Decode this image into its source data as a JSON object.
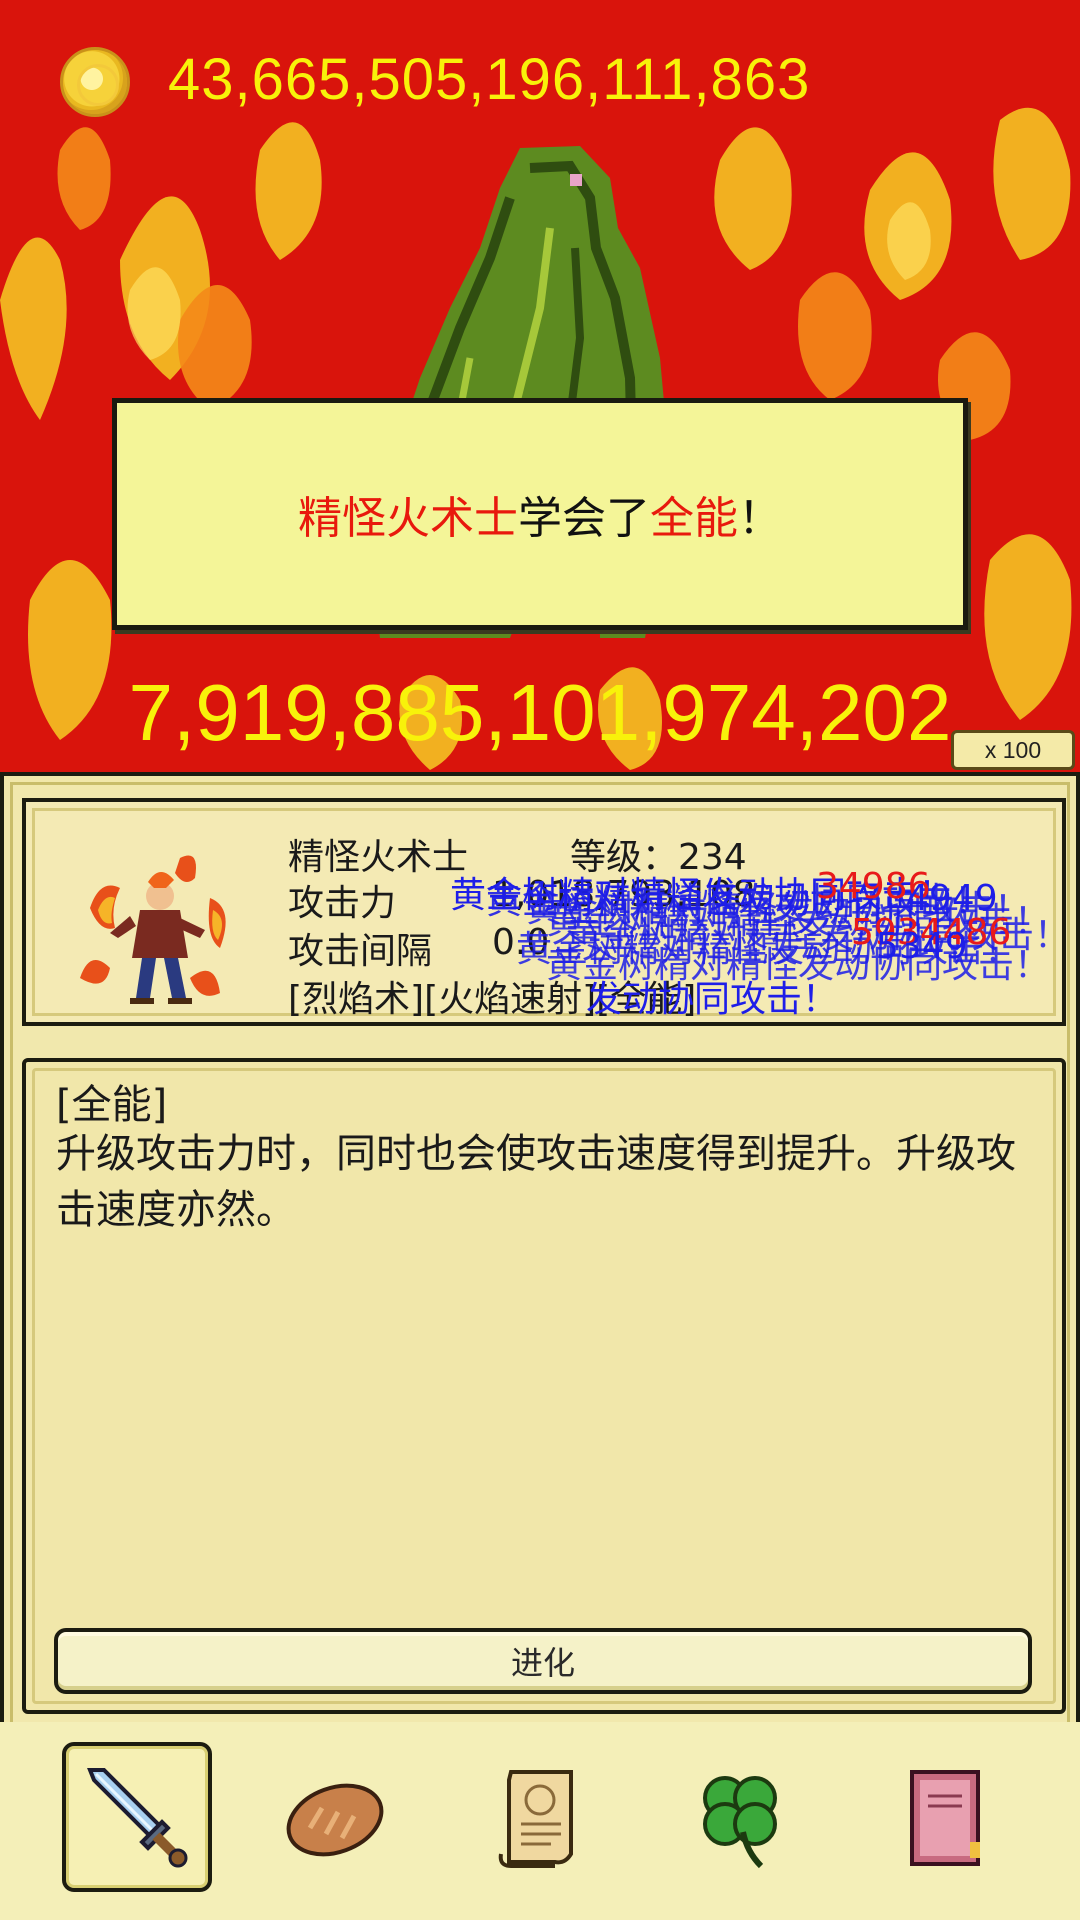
{
  "scene": {
    "gold_amount": "43,665,505,196,111,863",
    "damage_number": "7,919,885,101,974,202",
    "multiplier_label": "x 100",
    "dialog": {
      "part1": "精怪火术士",
      "part2": "学会了",
      "part3": "全能",
      "part4": "！"
    }
  },
  "unit": {
    "name": "精怪火术士",
    "level_label": "等级：234",
    "attack_label": "攻击力",
    "attack_value": "1,018,793,108",
    "interval_label": "攻击间隔",
    "interval_value": "0.0",
    "skills": "[烈焰术][火焰速射][全能]"
  },
  "floating_texts": [
    "黄金树精对精怪发动协同攻击！",
    "34986",
    "4949",
    "5934486",
    "5349",
    "发动协同攻击！"
  ],
  "skill_detail": {
    "title": "[全能]",
    "description": "升级攻击力时，同时也会使攻击速度得到提升。升级攻击速度亦然。"
  },
  "evolve_button_label": "进化",
  "tabs": [
    {
      "icon": "sword-icon"
    },
    {
      "icon": "bread-icon"
    },
    {
      "icon": "scroll-icon"
    },
    {
      "icon": "clover-icon"
    },
    {
      "icon": "book-icon"
    }
  ],
  "colors": {
    "scene_bg": "#d9140c",
    "gold_text": "#f8f20a",
    "highlight_red": "#e8190d",
    "panel_bg": "#f1e7aa",
    "float_blue": "#1e1ee8"
  }
}
